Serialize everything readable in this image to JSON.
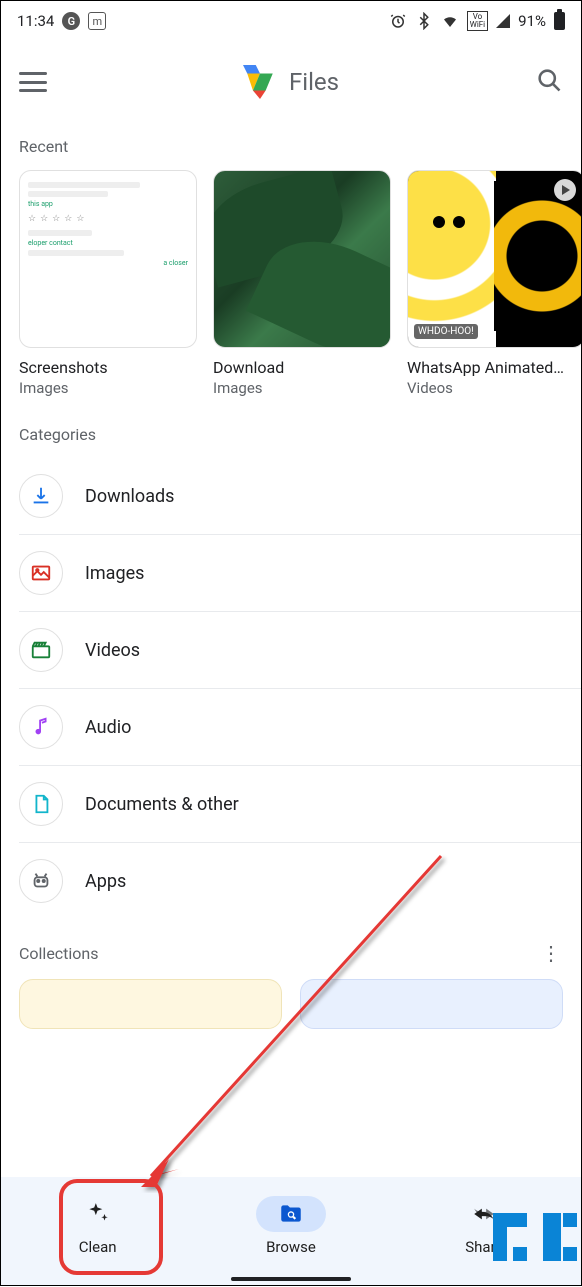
{
  "statusbar": {
    "time": "11:34",
    "battery_pct": "91%"
  },
  "appbar": {
    "title": "Files"
  },
  "sections": {
    "recent": "Recent",
    "categories": "Categories",
    "collections": "Collections"
  },
  "recent": [
    {
      "title": "Screenshots",
      "subtitle": "Images"
    },
    {
      "title": "Download",
      "subtitle": "Images"
    },
    {
      "title": "WhatsApp Animated…",
      "subtitle": "Videos"
    }
  ],
  "categories": [
    {
      "id": "downloads",
      "label": "Downloads",
      "icon": "download-icon",
      "color": "#1a73e8"
    },
    {
      "id": "images",
      "label": "Images",
      "icon": "image-icon",
      "color": "#d93025"
    },
    {
      "id": "videos",
      "label": "Videos",
      "icon": "video-clapper-icon",
      "color": "#188038"
    },
    {
      "id": "audio",
      "label": "Audio",
      "icon": "music-note-icon",
      "color": "#a142f4"
    },
    {
      "id": "documents",
      "label": "Documents & other",
      "icon": "document-icon",
      "color": "#12b5cb"
    },
    {
      "id": "apps",
      "label": "Apps",
      "icon": "android-icon",
      "color": "#5f6368"
    }
  ],
  "bottom_nav": {
    "clean": "Clean",
    "browse": "Browse",
    "share": "Share"
  }
}
